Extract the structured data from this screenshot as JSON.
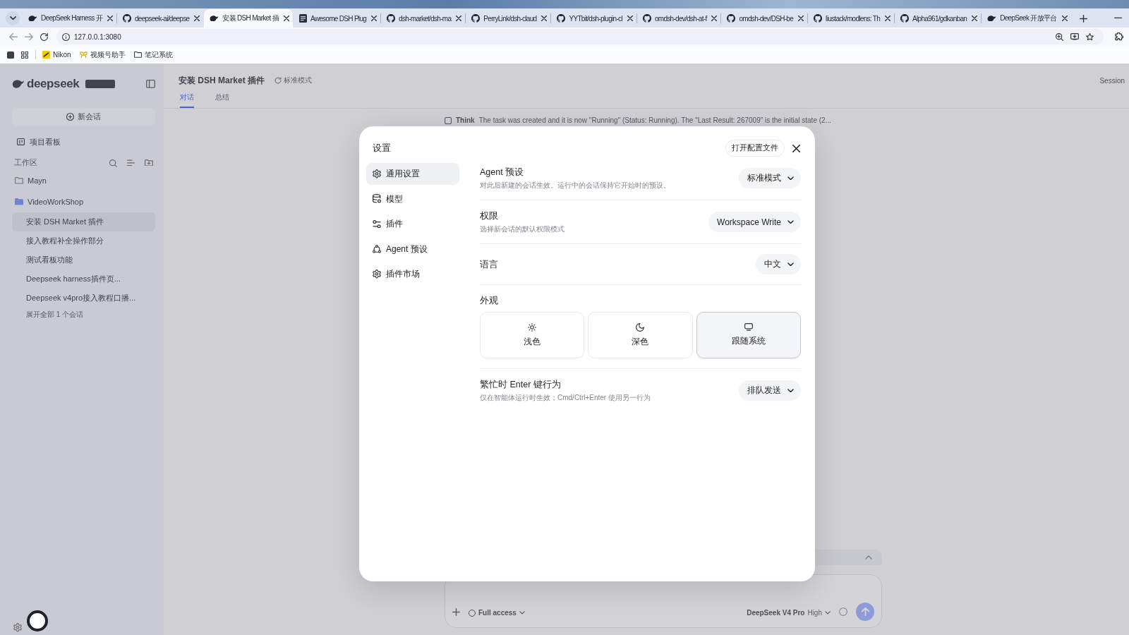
{
  "browser": {
    "tabs": [
      {
        "title": "DeepSeek Harness 开",
        "kind": "deepseek",
        "selected": false
      },
      {
        "title": "deepseek-ai/deepse",
        "kind": "github",
        "selected": false
      },
      {
        "title": "安装 DSH Market 插",
        "kind": "deepseek",
        "selected": true
      },
      {
        "title": "Awesome DSH Plug",
        "kind": "doc",
        "selected": false
      },
      {
        "title": "dsh-market/dsh-ma",
        "kind": "github",
        "selected": false
      },
      {
        "title": "PerryLink/dsh-claud",
        "kind": "github",
        "selected": false
      },
      {
        "title": "YYTbit/dsh-plugin-cl",
        "kind": "github",
        "selected": false
      },
      {
        "title": "omdsh-dev/dsh-at-f",
        "kind": "github",
        "selected": false
      },
      {
        "title": "omdsh-dev/DSH-be",
        "kind": "github",
        "selected": false
      },
      {
        "title": "liustack/modlens: Th",
        "kind": "github",
        "selected": false
      },
      {
        "title": "Alpha961/gdkanban",
        "kind": "github",
        "selected": false
      },
      {
        "title": "DeepSeek 开放平台",
        "kind": "deepseek",
        "selected": false
      }
    ],
    "address": "127.0.0.1:3080",
    "bookmarks": [
      {
        "label": "Nikon"
      },
      {
        "label": "视频号助手"
      },
      {
        "label": "笔记系统"
      }
    ]
  },
  "sidebar": {
    "brand": "deepseek",
    "new_chat": "新会话",
    "board": "项目看板",
    "section_label": "工作区",
    "projects": [
      {
        "name": "Mayn",
        "expanded": false
      },
      {
        "name": "VideoWorkShop",
        "expanded": true,
        "children": [
          {
            "title": "安装 DSH Market 插件",
            "selected": true
          },
          {
            "title": "接入教程补全操作部分",
            "selected": false
          },
          {
            "title": "测试看板功能",
            "selected": false
          },
          {
            "title": "Deepseek harness插件页...",
            "selected": false
          },
          {
            "title": "Deepseek v4pro接入教程口播...",
            "selected": false
          }
        ],
        "more": "展开全部 1 个会话"
      }
    ]
  },
  "main": {
    "title": "安装 DSH Market 插件",
    "mode": "标准模式",
    "session_label": "Session",
    "tabs": [
      {
        "label": "对话",
        "selected": true
      },
      {
        "label": "总结",
        "selected": false
      }
    ],
    "think": {
      "label": "Think",
      "text": "The task was created and it is now \"Running\" (Status: Running). The \"Last Result: 267009\" is the initial state (2..."
    },
    "composer": {
      "access": "Full access",
      "model": "DeepSeek V4 Pro",
      "effort": "High"
    }
  },
  "settings": {
    "title": "设置",
    "open_config": "打开配置文件",
    "nav": [
      {
        "label": "通用设置",
        "selected": true
      },
      {
        "label": "模型",
        "selected": false
      },
      {
        "label": "插件",
        "selected": false
      },
      {
        "label": "Agent 预设",
        "selected": false
      },
      {
        "label": "插件市场",
        "selected": false
      }
    ],
    "rows": [
      {
        "kind": "select",
        "title": "Agent 预设",
        "description": "对此后新建的会话生效。运行中的会话保持它开始时的预设。",
        "value": "标准模式"
      },
      {
        "kind": "select",
        "title": "权限",
        "description": "选择新会话的默认权限模式",
        "value": "Workspace Write"
      },
      {
        "kind": "select",
        "title": "语言",
        "value": "中文"
      },
      {
        "kind": "choice",
        "title": "外观",
        "options": [
          {
            "label": "浅色",
            "selected": false
          },
          {
            "label": "深色",
            "selected": false
          },
          {
            "label": "跟随系统",
            "selected": true
          }
        ]
      },
      {
        "kind": "select",
        "title": "繁忙时 Enter 键行为",
        "description": "仅在智能体运行时生效；Cmd/Ctrl+Enter 使用另一行为",
        "value": "排队发送"
      }
    ]
  }
}
